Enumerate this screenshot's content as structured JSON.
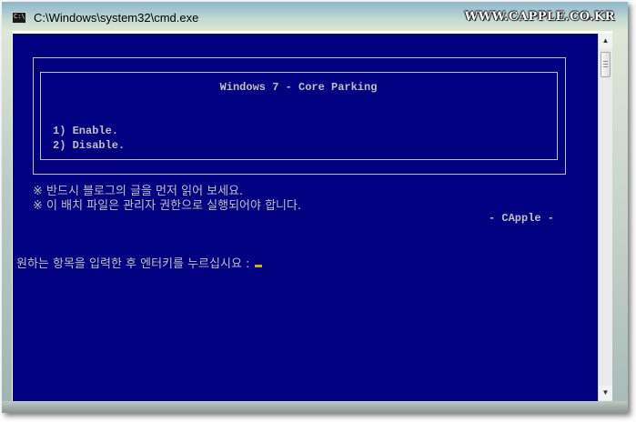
{
  "window": {
    "title": "C:\\Windows\\system32\\cmd.exe",
    "icon_text": "C:\\",
    "watermark": "WWW.CAPPLE.CO.KR"
  },
  "console": {
    "header": "Windows 7 - Core Parking",
    "options": [
      "1) Enable.",
      "2) Disable."
    ],
    "notices": [
      "※ 반드시 블로그의 글을 먼저 읽어 보세요.",
      "※ 이 배치 파일은 관리자 권한으로 실행되어야 합니다."
    ],
    "signature": "- CApple -",
    "prompt": "원하는 항목을 입력한 후 엔터키를 누르십시요 :"
  },
  "scrollbar": {
    "up_glyph": "▲",
    "down_glyph": "▼"
  },
  "colors": {
    "console_background": "#000080",
    "console_text": "#c0c0c0",
    "cursor": "#c8b400"
  }
}
